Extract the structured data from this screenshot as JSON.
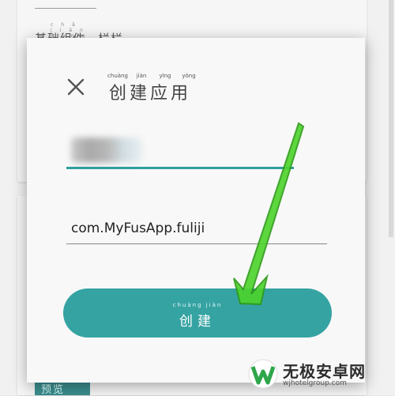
{
  "background": {
    "section_label": "基础组件、栏栏",
    "section_label_pinyin": "chǎ jiān dǐng lán",
    "preview_button": "预览"
  },
  "dialog": {
    "title": "创建应用",
    "title_pinyin": [
      "chuàng",
      "jiàn",
      "yīng",
      "yòng"
    ],
    "name_value_blurred": "",
    "package_value": "com.MyFusApp.fuliji",
    "create_button_label": "创建",
    "create_button_pinyin": "chuàng jiàn"
  },
  "colors": {
    "accent": "#35a3a2",
    "underline_active": "#2f9e9c",
    "annotation_arrow": "#4cd42a"
  },
  "icons": {
    "close": "close-icon",
    "arrow": "annotation-arrow-icon"
  },
  "watermark": {
    "name": "无极安卓网",
    "url": "wjhotelgroup.com"
  }
}
